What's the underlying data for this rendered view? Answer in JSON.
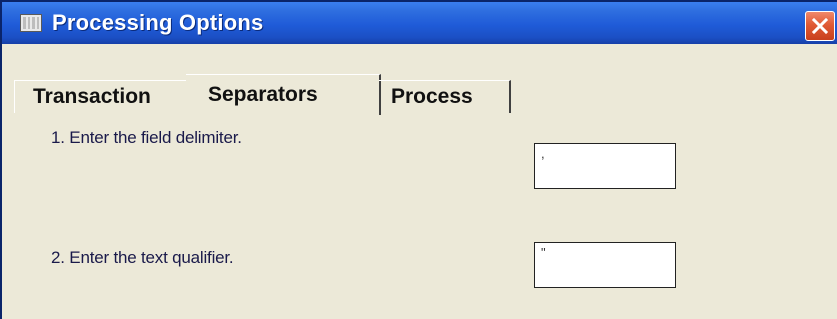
{
  "window": {
    "title": "Processing Options",
    "icon": "window-icon",
    "close_icon": "close-icon"
  },
  "tabs": [
    {
      "label": "Transaction",
      "selected": false
    },
    {
      "label": "Separators",
      "selected": true
    },
    {
      "label": "Process",
      "selected": false
    }
  ],
  "options": [
    {
      "label": "1. Enter the field delimiter.",
      "value": ","
    },
    {
      "label": "2. Enter the text qualifier.",
      "value": "\""
    }
  ],
  "colors": {
    "titlebar": "#1f5bd8",
    "close_button": "#e05a35",
    "background": "#ece9d8"
  }
}
